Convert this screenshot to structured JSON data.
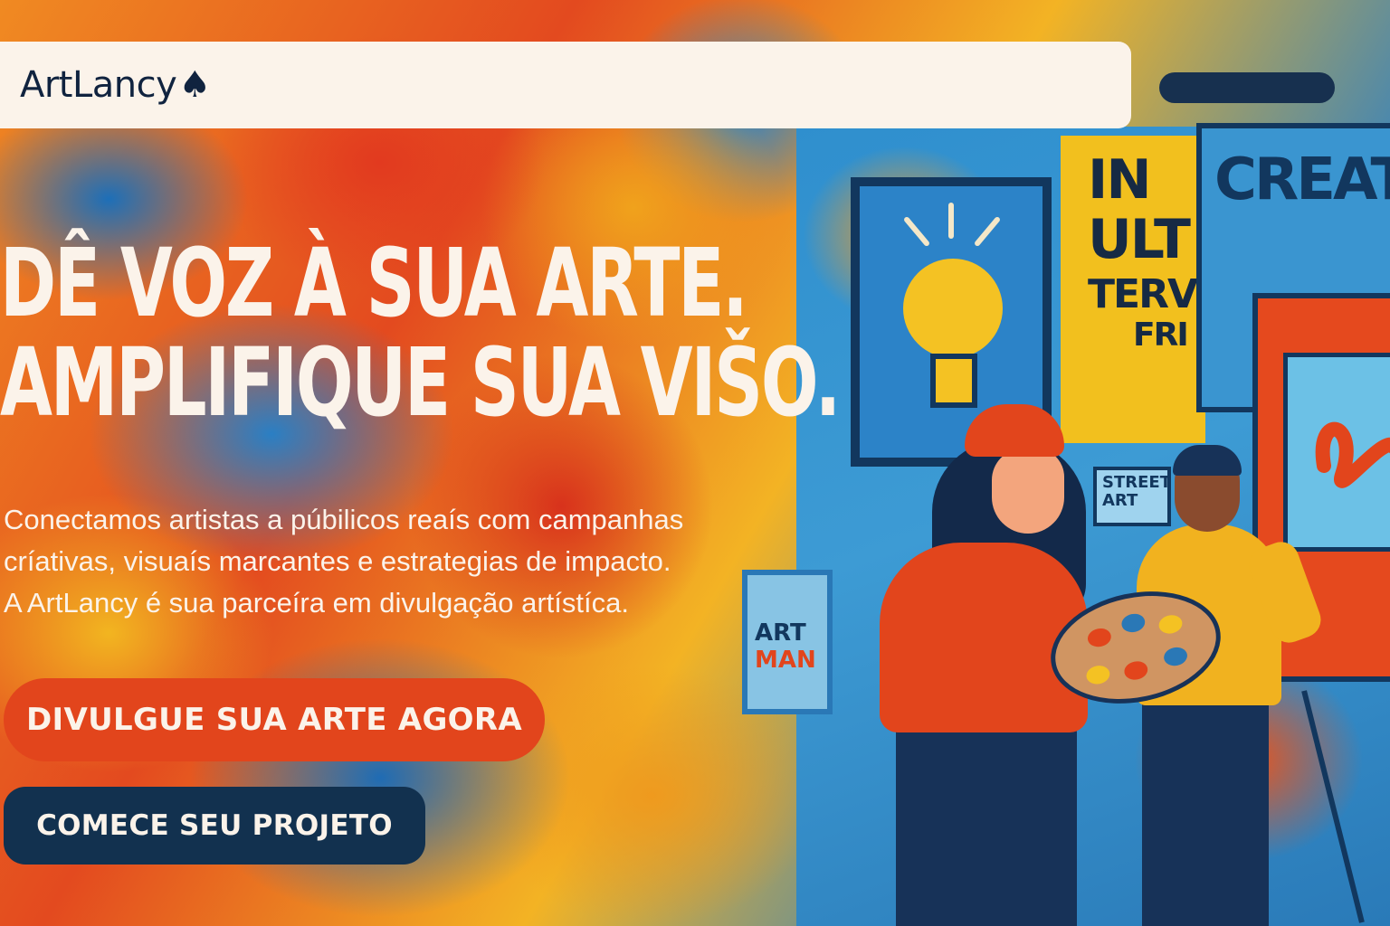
{
  "brand": {
    "name": "ArtLancy",
    "mark": "♠"
  },
  "hero": {
    "headline_line1": "DÊ VOZ À SUA ARTE.",
    "headline_line2": "AMPLIFIQUE SUA VIŠO.",
    "subtitle_line1": "Conectamos artistas a púbilicos reaís com campanhas",
    "subtitle_line2": "críativas, visuaís marcantes e estrategias de impacto.",
    "subtitle_line3": "A ArtLancy é sua parceíra em divulgação artístíca."
  },
  "buttons": {
    "primary_label": "DIVULGUE SUA ARTE AGORA",
    "secondary_label": "COMECE SEU PROJETO"
  },
  "illustration": {
    "poster_create": "CREATI",
    "poster_yellow_1": "IN",
    "poster_yellow_2": "ULT",
    "poster_yellow_3": "TERVC",
    "poster_yellow_4": "FRI",
    "poster_street": "STREET ART",
    "poster_art_1": "ART",
    "poster_art_2": "MAN"
  },
  "colors": {
    "accent": "#e2451c",
    "navy": "#12314f",
    "cream": "#fbf3ea"
  }
}
